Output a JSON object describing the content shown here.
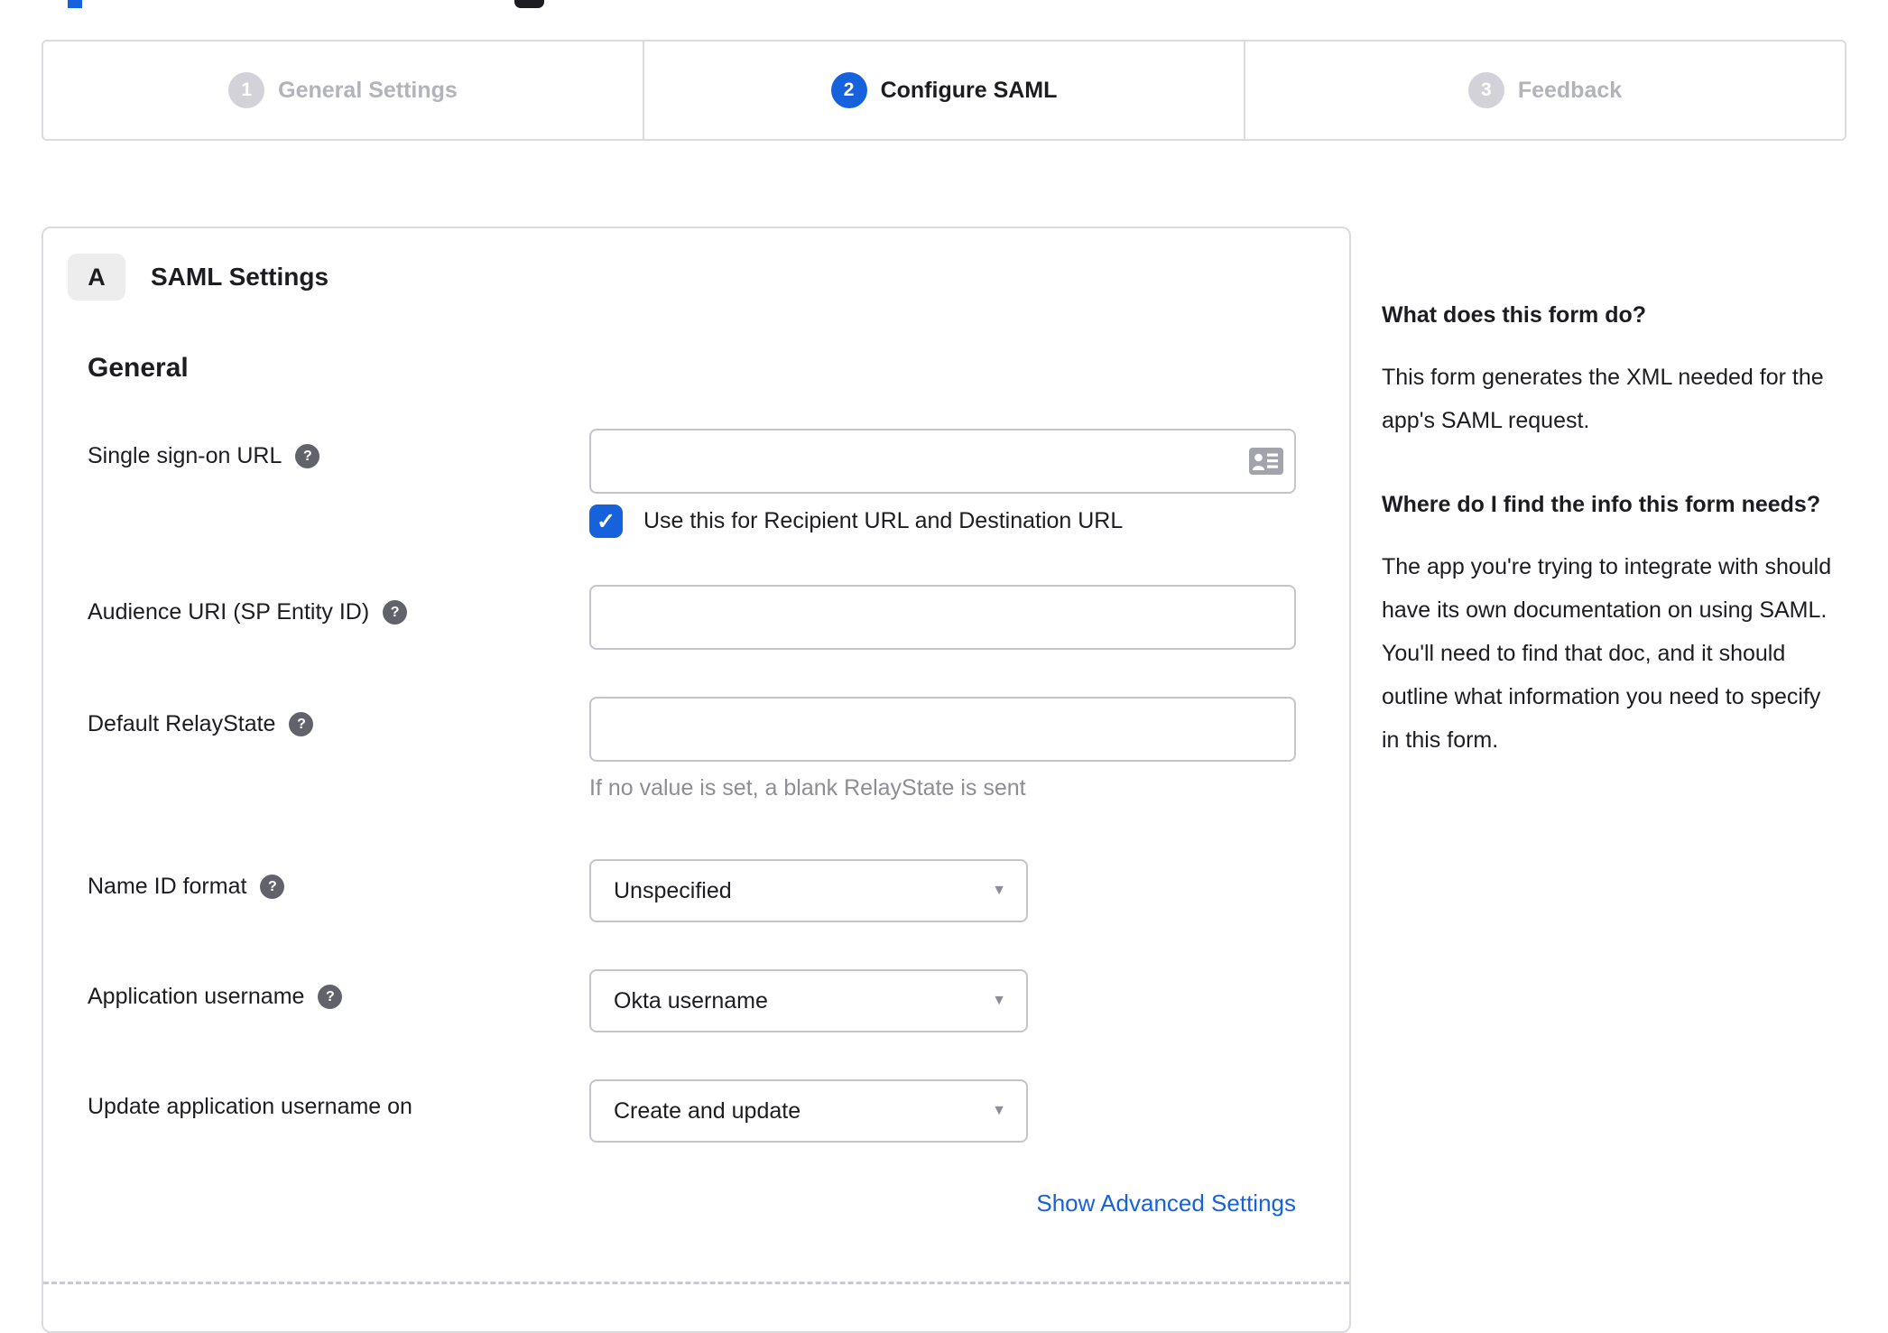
{
  "colors": {
    "accent_blue": "#1662dd",
    "inactive_gray": "#b3b3bb",
    "border_gray": "#dadae0",
    "input_border": "#c4c4cc",
    "hint_gray": "#8d8d95",
    "text": "#1d1d21"
  },
  "icons": {
    "help": "?",
    "check": "✓",
    "caret": "▼"
  },
  "stepper": {
    "steps": [
      {
        "number": "1",
        "label": "General Settings",
        "state": "inactive"
      },
      {
        "number": "2",
        "label": "Configure SAML",
        "state": "active"
      },
      {
        "number": "3",
        "label": "Feedback",
        "state": "inactive"
      }
    ]
  },
  "panel": {
    "section_badge": "A",
    "section_title": "SAML Settings",
    "group_heading": "General",
    "fields": [
      {
        "label": "Single sign-on URL",
        "has_help": true,
        "type": "text",
        "value": "",
        "trailing_icon": "contact-card-icon",
        "checkbox": {
          "checked": true,
          "label": "Use this for Recipient URL and Destination URL"
        }
      },
      {
        "label": "Audience URI (SP Entity ID)",
        "has_help": true,
        "type": "text",
        "value": ""
      },
      {
        "label": "Default RelayState",
        "has_help": true,
        "type": "text",
        "value": "",
        "hint": "If no value is set, a blank RelayState is sent"
      },
      {
        "label": "Name ID format",
        "has_help": true,
        "type": "select",
        "value": "Unspecified"
      },
      {
        "label": "Application username",
        "has_help": true,
        "type": "select",
        "value": "Okta username"
      },
      {
        "label": "Update application username on",
        "has_help": false,
        "type": "select",
        "value": "Create and update"
      }
    ],
    "advanced_link": "Show Advanced Settings"
  },
  "sidebar": {
    "blocks": [
      {
        "heading": "What does this form do?",
        "body": "This form generates the XML needed for the app's SAML request."
      },
      {
        "heading": "Where do I find the info this form needs?",
        "body": "The app you're trying to integrate with should have its own documentation on using SAML. You'll need to find that doc, and it should outline what information you need to specify in this form."
      }
    ]
  }
}
